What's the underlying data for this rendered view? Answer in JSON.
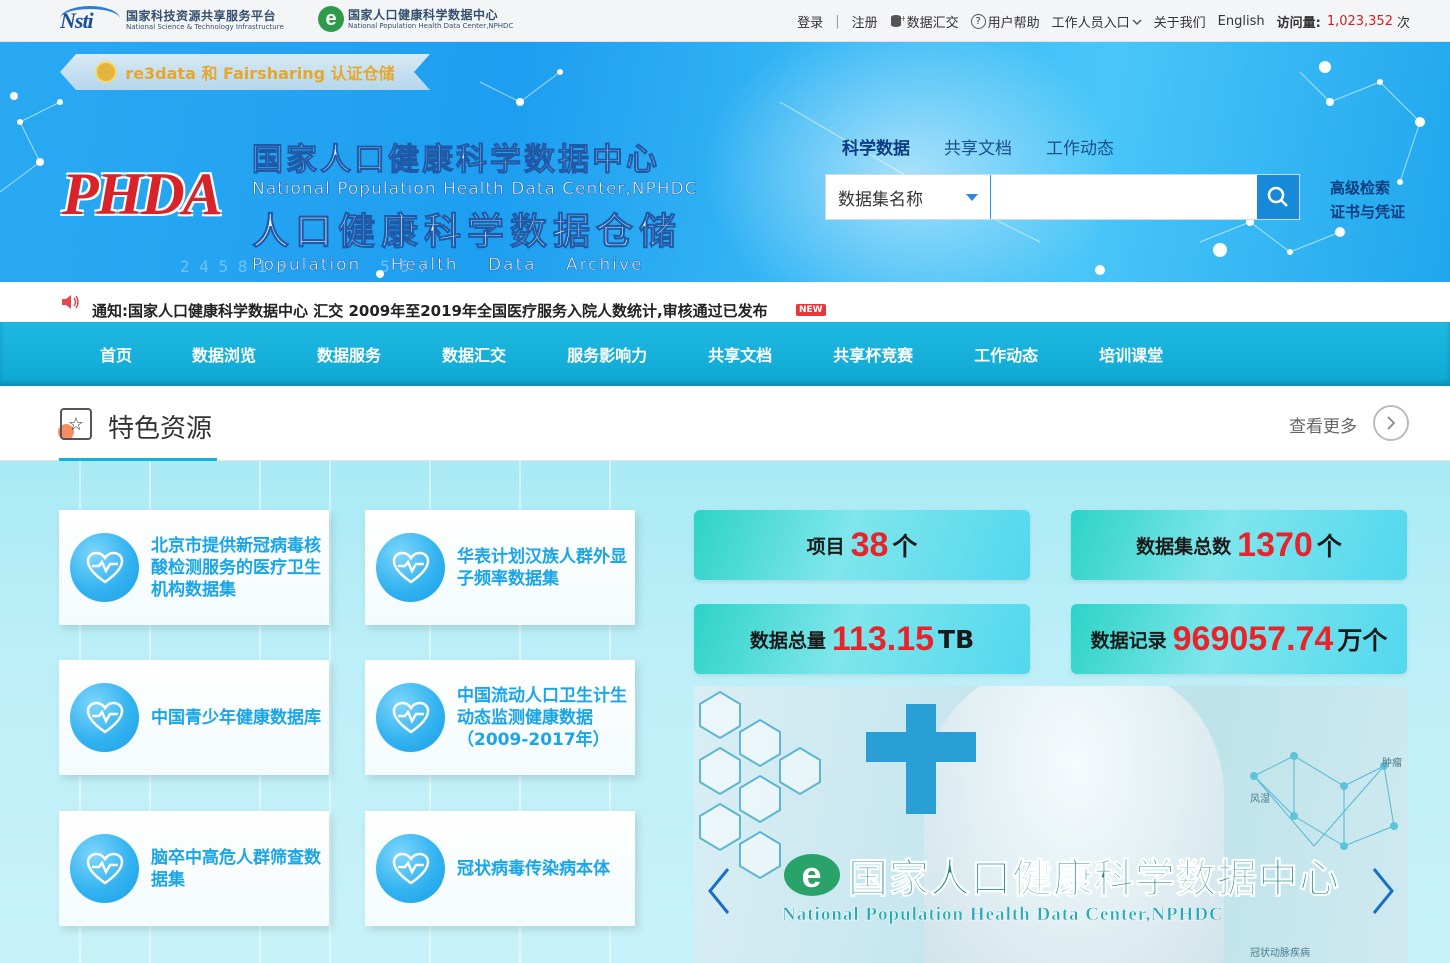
{
  "topbar": {
    "logo1": {
      "mark": "Nsti",
      "cn": "国家科技资源共享服务平台",
      "en": "National Science & Technology Infrastructure"
    },
    "logo2": {
      "mark": "e",
      "cn": "国家人口健康科学数据中心",
      "en": "National Population Health Data Center,NPHDC"
    },
    "nav": {
      "login": "登录",
      "register": "注册",
      "data_submit": "数据汇交",
      "help": "用户帮助",
      "staff": "工作人员入口",
      "about": "关于我们",
      "english": "English",
      "visits_label": "访问量:",
      "visits_value": "1,023,352",
      "visits_unit": "次"
    }
  },
  "banner": {
    "cert": "re3data 和 Fairsharing 认证仓储",
    "logo": "PHDA",
    "title_cn1": "国家人口健康科学数据中心",
    "title_en1": "National Population Health Data Center,NPHDC",
    "title_cn2": "人口健康科学数据仓储",
    "title_en2": "Population Health Data Archive",
    "search_tabs": [
      "科学数据",
      "共享文档",
      "工作动态"
    ],
    "search_select": "数据集名称",
    "search_placeholder": "",
    "side_links": [
      "高级检索",
      "证书与凭证"
    ]
  },
  "notice": {
    "text": "通知:国家人口健康科学数据中心 汇交 2009年至2019年全国医疗服务入院人数统计,审核通过已发布",
    "badge": "NEW"
  },
  "mainnav": [
    "首页",
    "数据浏览",
    "数据服务",
    "数据汇交",
    "服务影响力",
    "共享文档",
    "共享杯竞赛",
    "工作动态",
    "培训课堂"
  ],
  "section": {
    "title": "特色资源",
    "more": "查看更多"
  },
  "cards": [
    "北京市提供新冠病毒核酸检测服务的医疗卫生机构数据集",
    "华表计划汉族人群外显子频率数据集",
    "中国青少年健康数据库",
    "中国流动人口卫生计生动态监测健康数据（2009-2017年）",
    "脑卒中高危人群筛查数据集",
    "冠状病毒传染病本体"
  ],
  "stats": [
    {
      "label": "项目",
      "value": "38",
      "unit": "个"
    },
    {
      "label": "数据集总数",
      "value": "1370",
      "unit": "个"
    },
    {
      "label": "数据总量",
      "value": "113.15",
      "unit": "TB"
    },
    {
      "label": "数据记录",
      "value": "969057.74",
      "unit": "万个"
    }
  ],
  "slider": {
    "title": "国家人口健康科学数据中心",
    "mark": "e",
    "subtitle": "National Population Health Data Center,NPHDC",
    "tags": [
      "肿瘤",
      "冠状动脉疾病"
    ],
    "tag_left": "风湿"
  },
  "colors": {
    "nav_bg": "#0ea9d4",
    "card_text": "#1aa5e8",
    "stat_number": "#e8232a",
    "banner": "#1e9ef0"
  }
}
